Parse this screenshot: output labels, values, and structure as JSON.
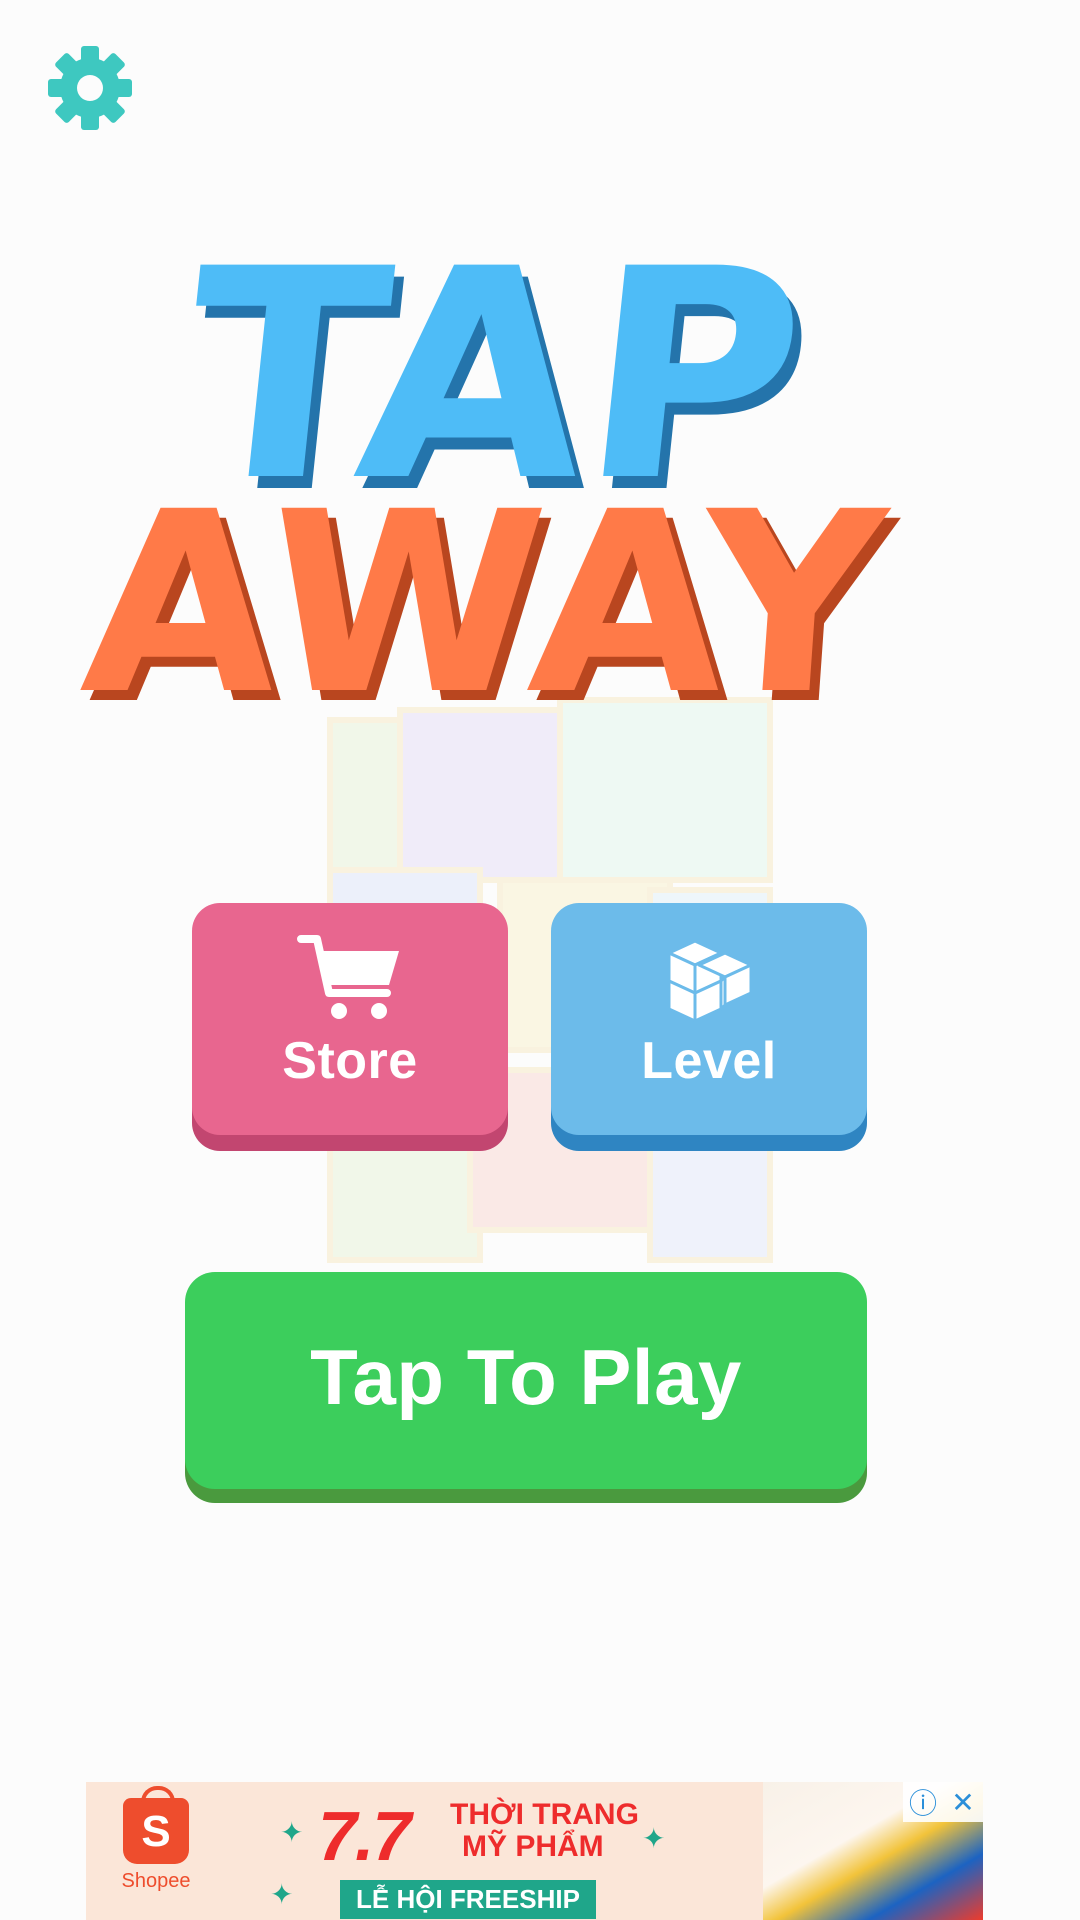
{
  "settings": {
    "icon": "gear-icon",
    "color": "#3ec8c0"
  },
  "logo": {
    "line1": "TAP",
    "line2": "AWAY",
    "line1_color": "#4ebcf7",
    "line2_color": "#ff7a48"
  },
  "menu": {
    "store": {
      "label": "Store",
      "icon": "cart-icon",
      "color": "#e8668f"
    },
    "level": {
      "label": "Level",
      "icon": "cubes-icon",
      "color": "#6cbbea"
    }
  },
  "play": {
    "label": "Tap To Play",
    "color": "#3cce5c"
  },
  "ad": {
    "brand": "Shopee",
    "logo_letter": "S",
    "promo_number": "7.7",
    "promo_line1": "THỜI TRANG",
    "promo_line2": "MỸ PHẨM",
    "promo_tag": "LỄ HỘI FREESHIP",
    "info_icon": "ⓘ",
    "close_icon": "✕"
  }
}
